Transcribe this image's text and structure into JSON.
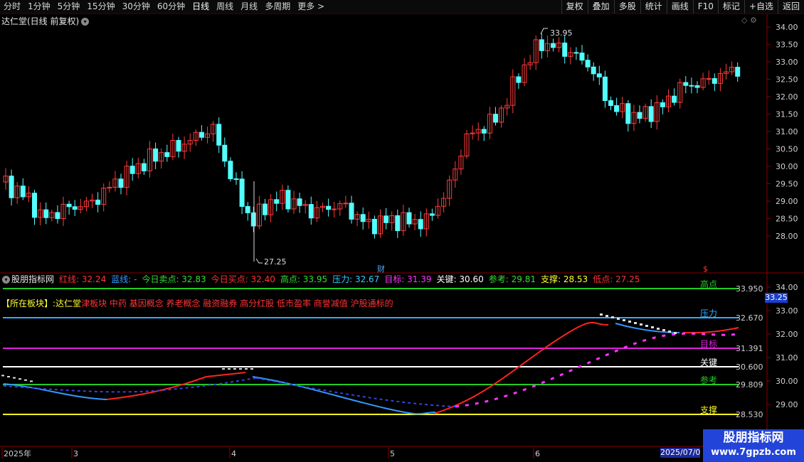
{
  "toolbar": {
    "periods": [
      "分时",
      "1分钟",
      "5分钟",
      "15分钟",
      "30分钟",
      "60分钟",
      "日线",
      "周线",
      "月线",
      "多周期",
      "更多 >"
    ],
    "active": "日线",
    "right_buttons": [
      "复权",
      "叠加",
      "多股",
      "统计",
      "画线",
      "F10",
      "标记",
      "+自选",
      "返回"
    ]
  },
  "chart": {
    "title": "达仁堂(日线 前复权)",
    "high_label": "33.95",
    "low_label": "27.25",
    "cai_label": "财",
    "dollar_label": "$",
    "y_ticks": [
      "34.00",
      "33.50",
      "33.00",
      "32.50",
      "32.00",
      "31.50",
      "31.00",
      "30.50",
      "30.00",
      "29.50",
      "29.00",
      "28.50",
      "28.00"
    ]
  },
  "indicator": {
    "name": "股朋指标网",
    "items": [
      {
        "label": "红线:",
        "value": "32.24",
        "color": "#ff3333"
      },
      {
        "label": "蓝线:",
        "value": "-",
        "color": "#3399ff"
      },
      {
        "label": "今日卖点:",
        "value": "32.83",
        "color": "#33dd33"
      },
      {
        "label": "今日买点:",
        "value": "32.40",
        "color": "#ff3333"
      },
      {
        "label": "高点:",
        "value": "33.95",
        "color": "#33dd33"
      },
      {
        "label": "压力:",
        "value": "32.67",
        "color": "#33ccff"
      },
      {
        "label": "目标:",
        "value": "31.39",
        "color": "#ff33ff"
      },
      {
        "label": "关键:",
        "value": "30.60",
        "color": "#ffffff"
      },
      {
        "label": "参考:",
        "value": "29.81",
        "color": "#33dd33"
      },
      {
        "label": "支撑:",
        "value": "28.53",
        "color": "#ffff33"
      },
      {
        "label": "低点:",
        "value": "27.25",
        "color": "#ff3333"
      }
    ],
    "sector_prefix": "【所在板块】:",
    "stock_name": "达仁堂",
    "sector_list": "津板块 中药 基因概念 养老概念 融资融券 高分红股 低市盈率 商誉减值 沪股通标的",
    "lines": {
      "high": "高点",
      "pressure": "压力",
      "target": "目标",
      "key": "关键",
      "ref": "参考",
      "support": "支撑"
    },
    "y_ticks": [
      "34.00",
      "33.00",
      "32.00",
      "31.00",
      "30.00",
      "29.00"
    ],
    "level_labels": [
      "33.950",
      "32.670",
      "31.391",
      "30.600",
      "29.809",
      "28.530"
    ],
    "current_price": "33.25"
  },
  "xaxis": {
    "labels": [
      "2025年",
      "3",
      "4",
      "5",
      "6"
    ],
    "date_tag": "2025/07/0"
  },
  "watermark": {
    "line1": "股朋指标网",
    "line2": "www.7gpzb.com"
  },
  "colors": {
    "up": "#ff3b3b",
    "down": "#54ffff",
    "bg": "#000000"
  }
}
